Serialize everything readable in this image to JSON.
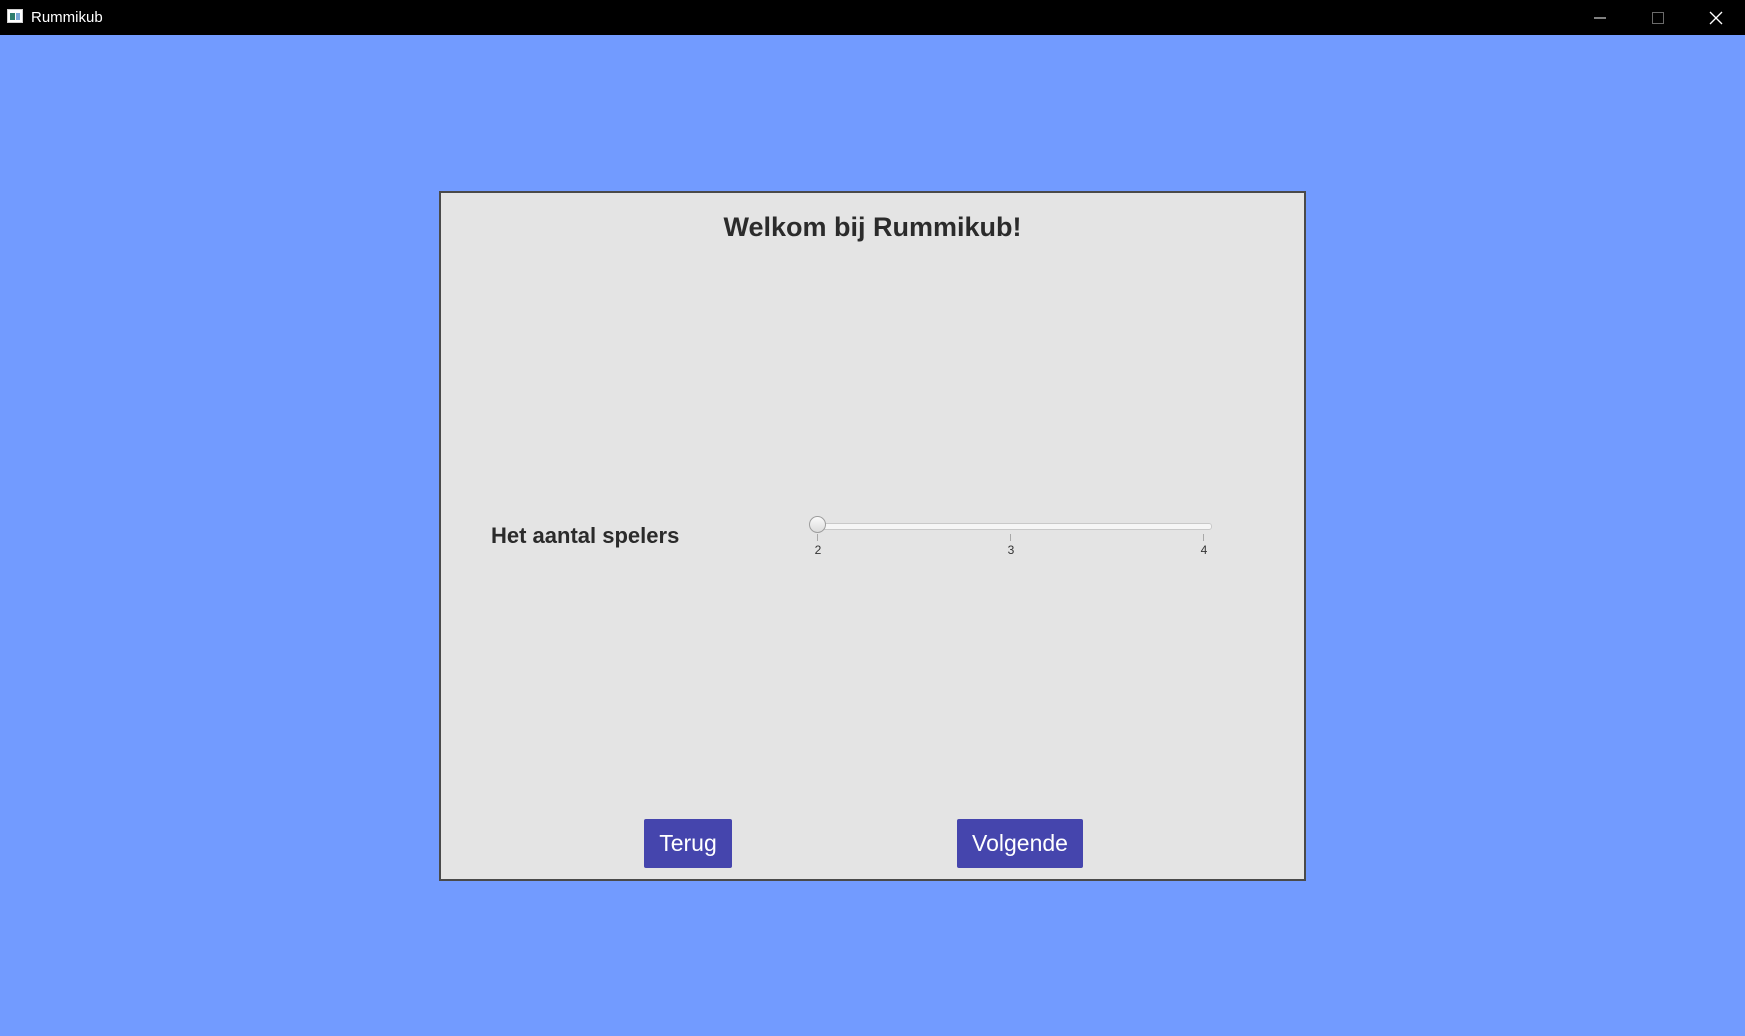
{
  "window": {
    "title": "Rummikub",
    "controls": [
      "minimize-icon",
      "maximize-icon",
      "close-icon"
    ]
  },
  "screen": {
    "heading": "Welkom bij Rummikub!",
    "players_label": "Het aantal spelers",
    "slider": {
      "min": 2,
      "max": 4,
      "value": 2,
      "ticks": [
        "2",
        "3",
        "4"
      ]
    },
    "back_button": "Terug",
    "next_button": "Volgende"
  },
  "colors": {
    "background": "#729bff",
    "panel": "#e4e4e4",
    "button": "#4545ad",
    "titlebar": "#000000"
  }
}
